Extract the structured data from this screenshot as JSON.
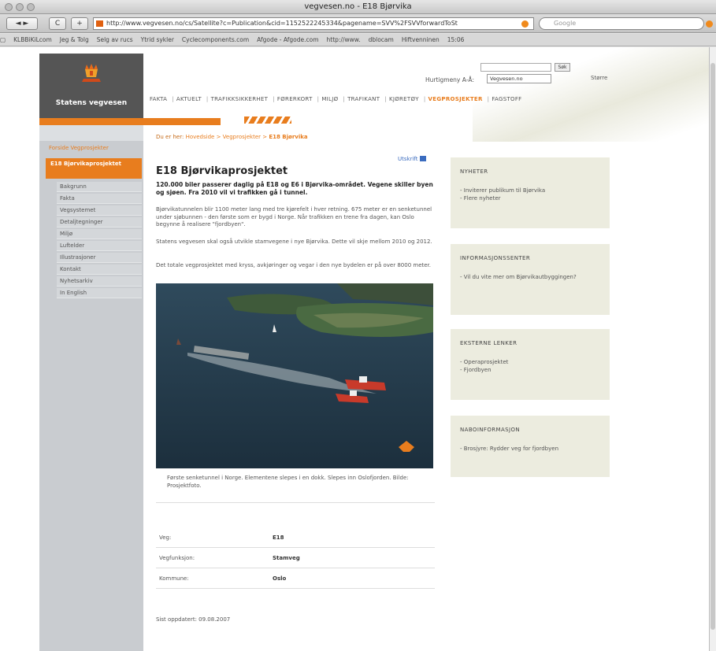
{
  "browser": {
    "window_title": "vegvesen.no - E18 Bjørvika",
    "url": "http://www.vegvesen.no/cs/Satellite?c=Publication&cid=1152522245334&pagename=SVV%2FSVVforwardToSt",
    "search_placeholder": "Google",
    "back_label": "◄ ►",
    "reload_label": "C",
    "add_label": "+",
    "bookmarks": [
      "KLBBiKiLcom",
      "Jeg & Tolg",
      "Selg av rucs",
      "Ytrid sykler",
      "Cyclecomponents.com",
      "Afgode - Afgode.com",
      "http://www.",
      "dblocam",
      "Hiftvenninen",
      "15:06"
    ]
  },
  "site": {
    "logo_text": "Statens vegvesen",
    "search_button": "Søk",
    "lang_label": "Hurtigmeny A-Å:",
    "lang_value": "Vegvesen.no",
    "font_label": "Større",
    "top_nav": [
      "FAKTA",
      "AKTUELT",
      "TRAFIKKSIKKERHET",
      "FØRERKORT",
      "MILJØ",
      "TRAFIKANT",
      "KJØRETØY",
      "VEGPROSJEKTER",
      "FAGSTOFF"
    ],
    "top_nav_active": "VEGPROSJEKTER"
  },
  "breadcrumb": {
    "label": "Du er her:",
    "items": [
      "Hovedside",
      "Vegprosjekter"
    ],
    "current": "E18 Bjørvika"
  },
  "left_menu": {
    "parent": "Forside Vegprosjekter",
    "current": "E18 Bjørvikaprosjektet",
    "items": [
      "Bakgrunn",
      "Fakta",
      "Vegsystemet",
      "Detaljtegninger",
      "Miljø",
      "Luftelder",
      "Illustrasjoner",
      "Kontakt",
      "Nyhetsarkiv",
      "In English"
    ]
  },
  "article": {
    "print_label": "Utskrift",
    "title": "E18 Bjørvikaprosjektet",
    "lead": "120.000 biler passerer daglig på E18 og E6 i Bjørvika-området. Vegene skiller byen og sjøen. Fra 2010 vil vi trafikken gå i tunnel.",
    "paragraphs": [
      "Bjørvikatunnelen blir 1100 meter lang med tre kjørefelt i hver retning. 675 meter er en senketunnel under sjøbunnen - den første som er bygd i Norge. Når trafikken en trene fra dagen, kan Oslo begynne å realisere \"fjordbyen\".",
      "Statens vegvesen skal også utvikle stamvegene i nye Bjørvika. Dette vil skje mellom 2010 og 2012.",
      "Det totale vegprosjektet med kryss, avkjøringer og vegar i den nye bydelen er på over 8000 meter."
    ],
    "caption": "Første senketunnel i Norge. Elementene slepes i en dokk. Slepes inn Oslofjorden. Bilde: Prosjektfoto.",
    "info": [
      {
        "key": "Veg:",
        "value": "E18"
      },
      {
        "key": "Vegfunksjon:",
        "value": "Stamveg"
      },
      {
        "key": "Kommune:",
        "value": "Oslo"
      }
    ],
    "updated": "Sist oppdatert: 09.08.2007"
  },
  "sidebar": [
    {
      "title": "NYHETER",
      "items": [
        "- Inviterer publikum til Bjørvika",
        "- Flere nyheter"
      ]
    },
    {
      "title": "INFORMASJONSSENTER",
      "items": [
        "- Vil du vite mer om Bjørvikautbyggingen?"
      ]
    },
    {
      "title": "EKSTERNE LENKER",
      "items": [
        "- Operaprosjektet",
        "- Fjordbyen"
      ]
    },
    {
      "title": "NABOINFORMASJON",
      "items": [
        "- Brosjyre: Rydder veg for fjordbyen"
      ]
    }
  ],
  "colors": {
    "accent": "#e87d1e",
    "menu_bg": "#c9ccd0",
    "sidebar_box": "#ececdf",
    "link": "#3b6cbf"
  }
}
